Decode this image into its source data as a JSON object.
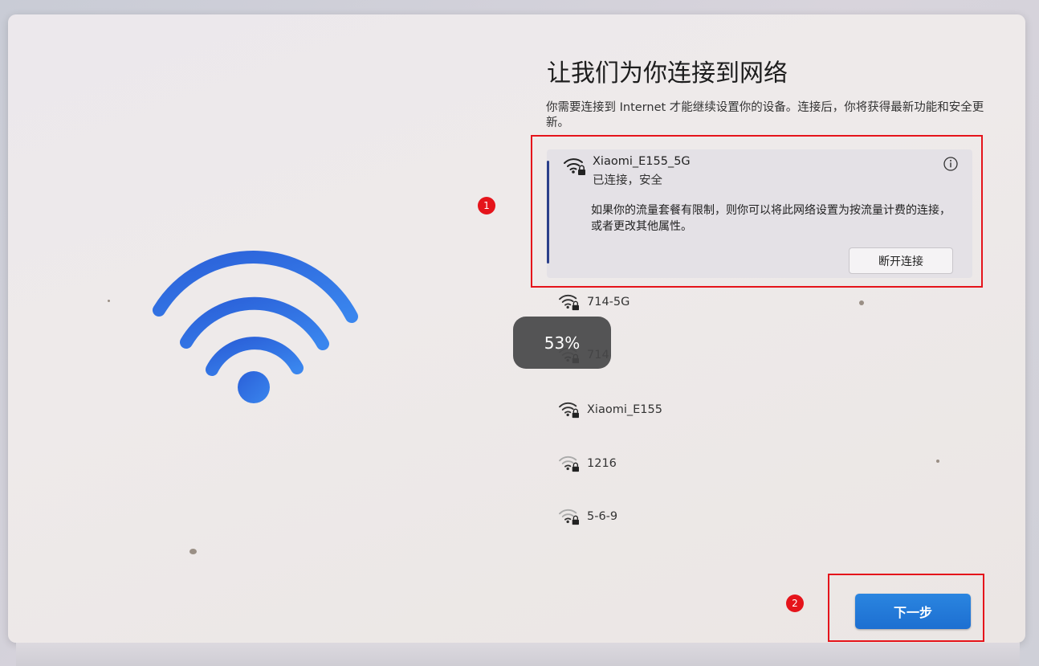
{
  "page": {
    "title": "让我们为你连接到网络",
    "subtitle": "你需要连接到 Internet 才能继续设置你的设备。连接后，你将获得最新功能和安全更新。"
  },
  "connected_network": {
    "ssid": "Xiaomi_E155_5G",
    "status": "已连接，安全",
    "description": "如果你的流量套餐有限制，则你可以将此网络设置为按流量计费的连接，或者更改其他属性。",
    "disconnect_label": "断开连接"
  },
  "networks": [
    {
      "ssid": "714-5G"
    },
    {
      "ssid": "714"
    },
    {
      "ssid": "Xiaomi_E155"
    },
    {
      "ssid": "1216"
    },
    {
      "ssid": "5-6-9"
    }
  ],
  "toast": {
    "text": "53%"
  },
  "next_button": {
    "label": "下一步"
  },
  "annotations": [
    {
      "label": "1"
    },
    {
      "label": "2"
    }
  ],
  "colors": {
    "accent_blue": "#1d6fd1",
    "annotation_red": "#e5141b",
    "wifi_blue": "#2f6fe0"
  }
}
